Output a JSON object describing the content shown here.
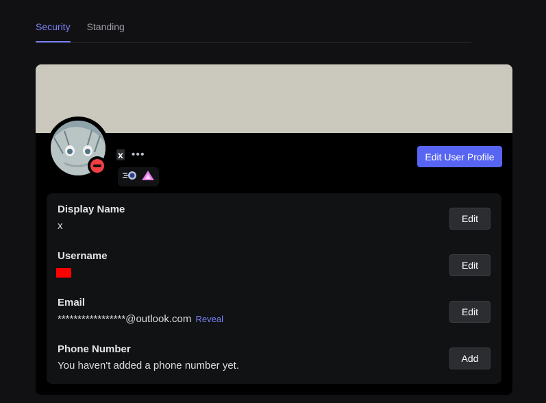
{
  "tabs": [
    {
      "label": "Security",
      "active": true
    },
    {
      "label": "Standing",
      "active": false
    }
  ],
  "profile": {
    "display_tag": "x",
    "more_icon": "ellipsis-icon",
    "status": "do-not-disturb",
    "badges": [
      "speed-badge-icon",
      "triangle-badge-icon"
    ],
    "edit_profile_label": "Edit User Profile",
    "banner_color": "#cbc8be",
    "accent_color": "#5865f2"
  },
  "account": {
    "display_name": {
      "label": "Display Name",
      "value": "x",
      "button": "Edit"
    },
    "username": {
      "label": "Username",
      "value": "",
      "button": "Edit"
    },
    "email": {
      "label": "Email",
      "value": "*****************@outlook.com",
      "reveal": "Reveal",
      "button": "Edit"
    },
    "phone": {
      "label": "Phone Number",
      "value": "You haven't added a phone number yet.",
      "button": "Add"
    }
  }
}
